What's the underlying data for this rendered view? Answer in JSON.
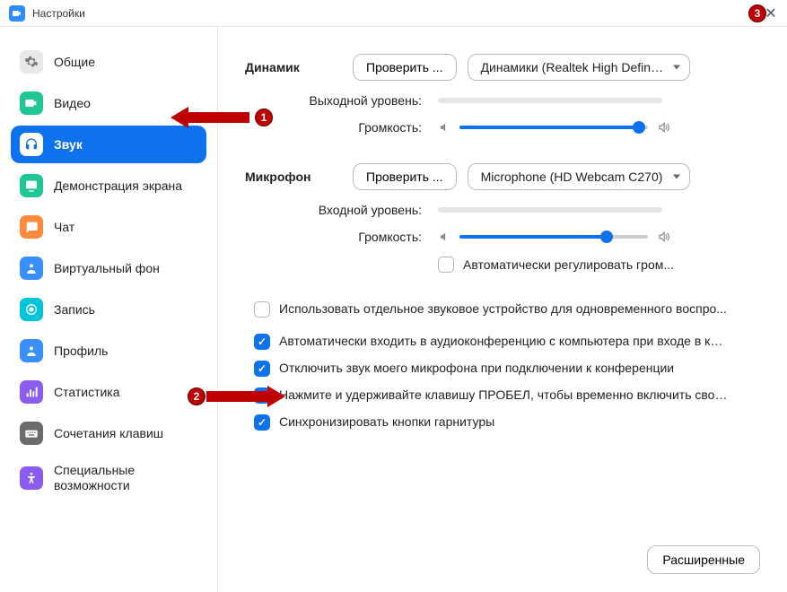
{
  "window": {
    "title": "Настройки"
  },
  "annotations": {
    "b1": "1",
    "b2": "2",
    "b3": "3"
  },
  "sidebar": {
    "items": [
      {
        "label": "Общие"
      },
      {
        "label": "Видео"
      },
      {
        "label": "Звук"
      },
      {
        "label": "Демонстрация экрана"
      },
      {
        "label": "Чат"
      },
      {
        "label": "Виртуальный фон"
      },
      {
        "label": "Запись"
      },
      {
        "label": "Профиль"
      },
      {
        "label": "Статистика"
      },
      {
        "label": "Сочетания клавиш"
      },
      {
        "label": "Специальные возможности"
      }
    ]
  },
  "audio": {
    "speaker": {
      "title": "Динамик",
      "test": "Проверить ...",
      "device": "Динамики (Realtek High Definitio...",
      "output_level_label": "Выходной уровень:",
      "volume_label": "Громкость:",
      "volume_pct": 95
    },
    "mic": {
      "title": "Микрофон",
      "test": "Проверить ...",
      "device": "Microphone (HD Webcam C270)",
      "input_level_label": "Входной уровень:",
      "volume_label": "Громкость:",
      "volume_pct": 78,
      "auto_adjust": "Автоматически регулировать гром..."
    },
    "options": {
      "separate_device": "Использовать отдельное звуковое устройство для одновременного воспро...",
      "auto_join": "Автоматически входить в аудиоконференцию с компьютера при входе в кон...",
      "mute_on_join": "Отключить звук моего микрофона при подключении к конференции",
      "push_to_talk": "Нажмите и удерживайте клавишу ПРОБЕЛ, чтобы временно включить свой з...",
      "sync_headset": "Синхронизировать кнопки гарнитуры"
    },
    "advanced": "Расширенные"
  }
}
